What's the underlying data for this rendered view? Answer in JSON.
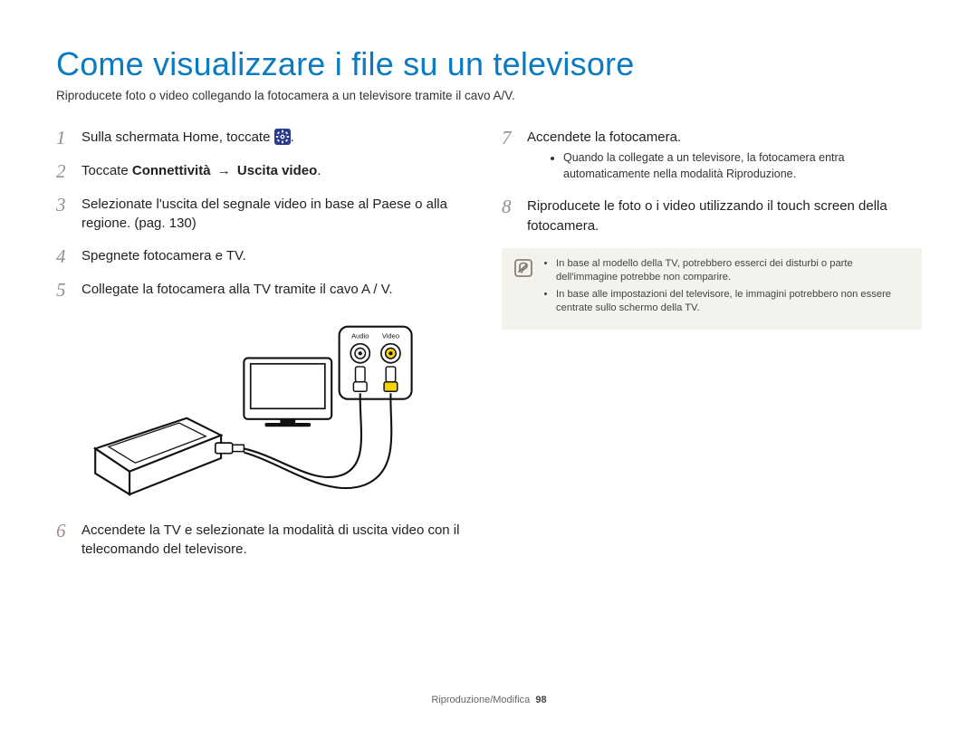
{
  "title": "Come visualizzare i file su un televisore",
  "subtitle": "Riproducete foto o video collegando la fotocamera a un televisore tramite il cavo A/V.",
  "left_steps": [
    {
      "num": "1",
      "text_pre": "Sulla schermata Home, toccate ",
      "has_icon": true,
      "text_post": "."
    },
    {
      "num": "2",
      "text_pre": "Toccate ",
      "bold1": "Connettività",
      "arrow": "→",
      "bold2": "Uscita video",
      "text_post": "."
    },
    {
      "num": "3",
      "text": "Selezionate l'uscita del segnale video in base al Paese o alla regione. (pag. 130)"
    },
    {
      "num": "4",
      "text": "Spegnete fotocamera e TV."
    },
    {
      "num": "5",
      "text": "Collegate la fotocamera alla TV tramite il cavo A / V."
    }
  ],
  "left_step6": {
    "num": "6",
    "text": "Accendete la TV e selezionate la modalità di uscita video con il telecomando del televisore."
  },
  "diagram": {
    "audio_label": "Audio",
    "video_label": "Video"
  },
  "right_step7": {
    "num": "7",
    "text": "Accendete la fotocamera.",
    "sub": [
      "Quando la collegate a un televisore, la fotocamera entra automaticamente nella modalità Riproduzione."
    ]
  },
  "right_step8": {
    "num": "8",
    "text": "Riproducete le foto o i video utilizzando il touch screen della fotocamera."
  },
  "notes": [
    "In base al modello della TV, potrebbero esserci dei disturbi o parte dell'immagine potrebbe non comparire.",
    "In base alle impostazioni del televisore, le immagini potrebbero non essere centrate sullo schermo della TV."
  ],
  "footer": {
    "section": "Riproduzione/Modifica",
    "page": "98"
  }
}
